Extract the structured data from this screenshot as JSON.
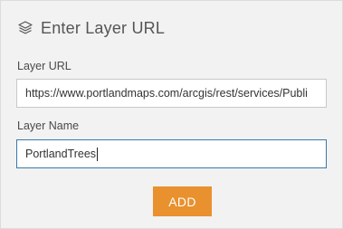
{
  "header": {
    "icon": "layers-icon",
    "title": "Enter Layer URL"
  },
  "form": {
    "url_label": "Layer URL",
    "url_value": "https://www.portlandmaps.com/arcgis/rest/services/Publi",
    "name_label": "Layer Name",
    "name_value": "PortlandTrees",
    "add_label": "ADD"
  },
  "colors": {
    "accent": "#e8912e",
    "focus_border": "#3a79a8"
  }
}
